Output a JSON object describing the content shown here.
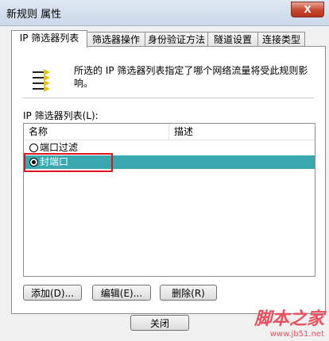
{
  "window": {
    "title": "新规则 属性",
    "close_label": "X"
  },
  "tabs": [
    {
      "label": "IP 筛选器列表",
      "active": true
    },
    {
      "label": "筛选器操作",
      "active": false
    },
    {
      "label": "身份验证方法",
      "active": false
    },
    {
      "label": "隧道设置",
      "active": false
    },
    {
      "label": "连接类型",
      "active": false
    }
  ],
  "panel": {
    "icon": "filter-list-icon",
    "description": "所选的 IP 筛选器列表指定了哪个网络流量将受此规则影响。",
    "list_label": "IP 筛选器列表(L):",
    "columns": [
      "名称",
      "描述"
    ],
    "rows": [
      {
        "name": "端口过滤",
        "description": "",
        "checked": false,
        "selected": false
      },
      {
        "name": "封端口",
        "description": "",
        "checked": true,
        "selected": true
      }
    ],
    "buttons": {
      "add": "添加(D)...",
      "edit": "编辑(E)...",
      "delete": "删除(R)"
    }
  },
  "footer": {
    "close": "关闭"
  },
  "watermark": {
    "main": "脚本之家",
    "url": "www.jb51.net"
  },
  "colors": {
    "selection": "#38a7ae",
    "highlight_box": "#e0141e",
    "watermark": "#e8505e"
  }
}
